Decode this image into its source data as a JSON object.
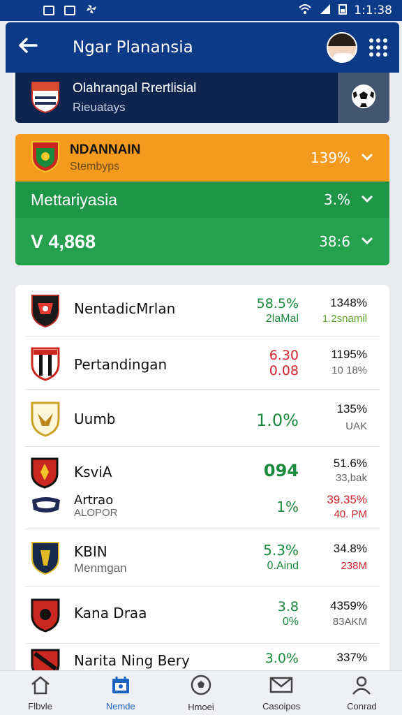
{
  "status": {
    "time": "1:1:38"
  },
  "appbar": {
    "title": "Ngar Planansia"
  },
  "league": {
    "name": "Olahrangal Rrertlisial",
    "sub": "Rieuatays"
  },
  "highlight": {
    "orange": {
      "name": "NDANNAIN",
      "sub": "Stembyps",
      "value": "139%"
    },
    "green1": {
      "name": "Mettariyasia",
      "value": "3.%"
    },
    "green2": {
      "name": "V 4,868",
      "value": "38:6"
    }
  },
  "rows": [
    {
      "name": "NentadicMrlan",
      "sub": "",
      "c1": "58.5%",
      "c1s": "2laMal",
      "c2": "1348%",
      "c2s": "1.2snamil"
    },
    {
      "name": "Pertandingan",
      "sub": "",
      "c1": "6.30",
      "c1s": "0.08",
      "c2": "1195%",
      "c2s": "10 18%"
    },
    {
      "name": "Uumb",
      "sub": "",
      "c1": "1.0%",
      "c1s": "",
      "c2": "135%",
      "c2s": "UAK"
    },
    {
      "name": "KsviA",
      "sub": "",
      "c1": "094",
      "c1s": "",
      "c2": "51.6%",
      "c2s": "33,bak"
    },
    {
      "name": "Artrao",
      "sub": "ALOPOR",
      "c1": "1%",
      "c1s": "",
      "c2": "39.35%",
      "c2s": "40. PM"
    },
    {
      "name": "KBIN",
      "sub": "Menmgan",
      "c1": "5.3%",
      "c1s": "0.Aind",
      "c2": "34.8%",
      "c2s": "238M"
    },
    {
      "name": "Kana Draa",
      "sub": "",
      "c1": "3.8",
      "c1s": "0%",
      "c2": "4359%",
      "c2s": "83AKM"
    },
    {
      "name": "Narita Ning Bery",
      "sub": "",
      "c1": "3.0%",
      "c1s": "",
      "c2": "337%",
      "c2s": ""
    }
  ],
  "nav": [
    {
      "label": "Flbvle",
      "icon": "home-icon"
    },
    {
      "label": "Nemde",
      "icon": "calendar-icon"
    },
    {
      "label": "Hmoei",
      "icon": "ball-icon"
    },
    {
      "label": "Casoipos",
      "icon": "mail-icon"
    },
    {
      "label": "Conrad",
      "icon": "profile-icon"
    }
  ],
  "colors": {
    "primary": "#0d3a86",
    "orange": "#f39a1f",
    "green": "#1f9548",
    "up": "#1a8a3c",
    "down": "#d4232f"
  }
}
